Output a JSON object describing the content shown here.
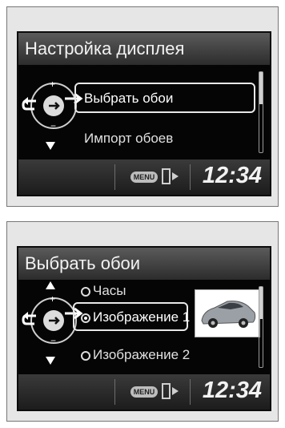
{
  "screen1": {
    "title": "Настройка дисплея",
    "selected_item": "Выбрать обои",
    "next_item": "Импорт обоев",
    "menu_label": "MENU",
    "clock": "12:34"
  },
  "screen2": {
    "title": "Выбрать обои",
    "options": [
      {
        "label": "Часы",
        "selected": false
      },
      {
        "label": "Изображение 1",
        "selected": true
      },
      {
        "label": "Изображение 2",
        "selected": false
      }
    ],
    "menu_label": "MENU",
    "clock": "12:34"
  },
  "colors": {
    "screen_bg": "#050505",
    "title_bar": "#4a4a4a",
    "text": "#e0e0e0",
    "panel_bg": "#e6e6e6"
  },
  "icons": [
    "selector-dial-icon",
    "back-arrow-icon",
    "up-arrow-icon",
    "down-arrow-icon",
    "menu-icon",
    "phone-exit-icon",
    "car-thumbnail-icon"
  ]
}
